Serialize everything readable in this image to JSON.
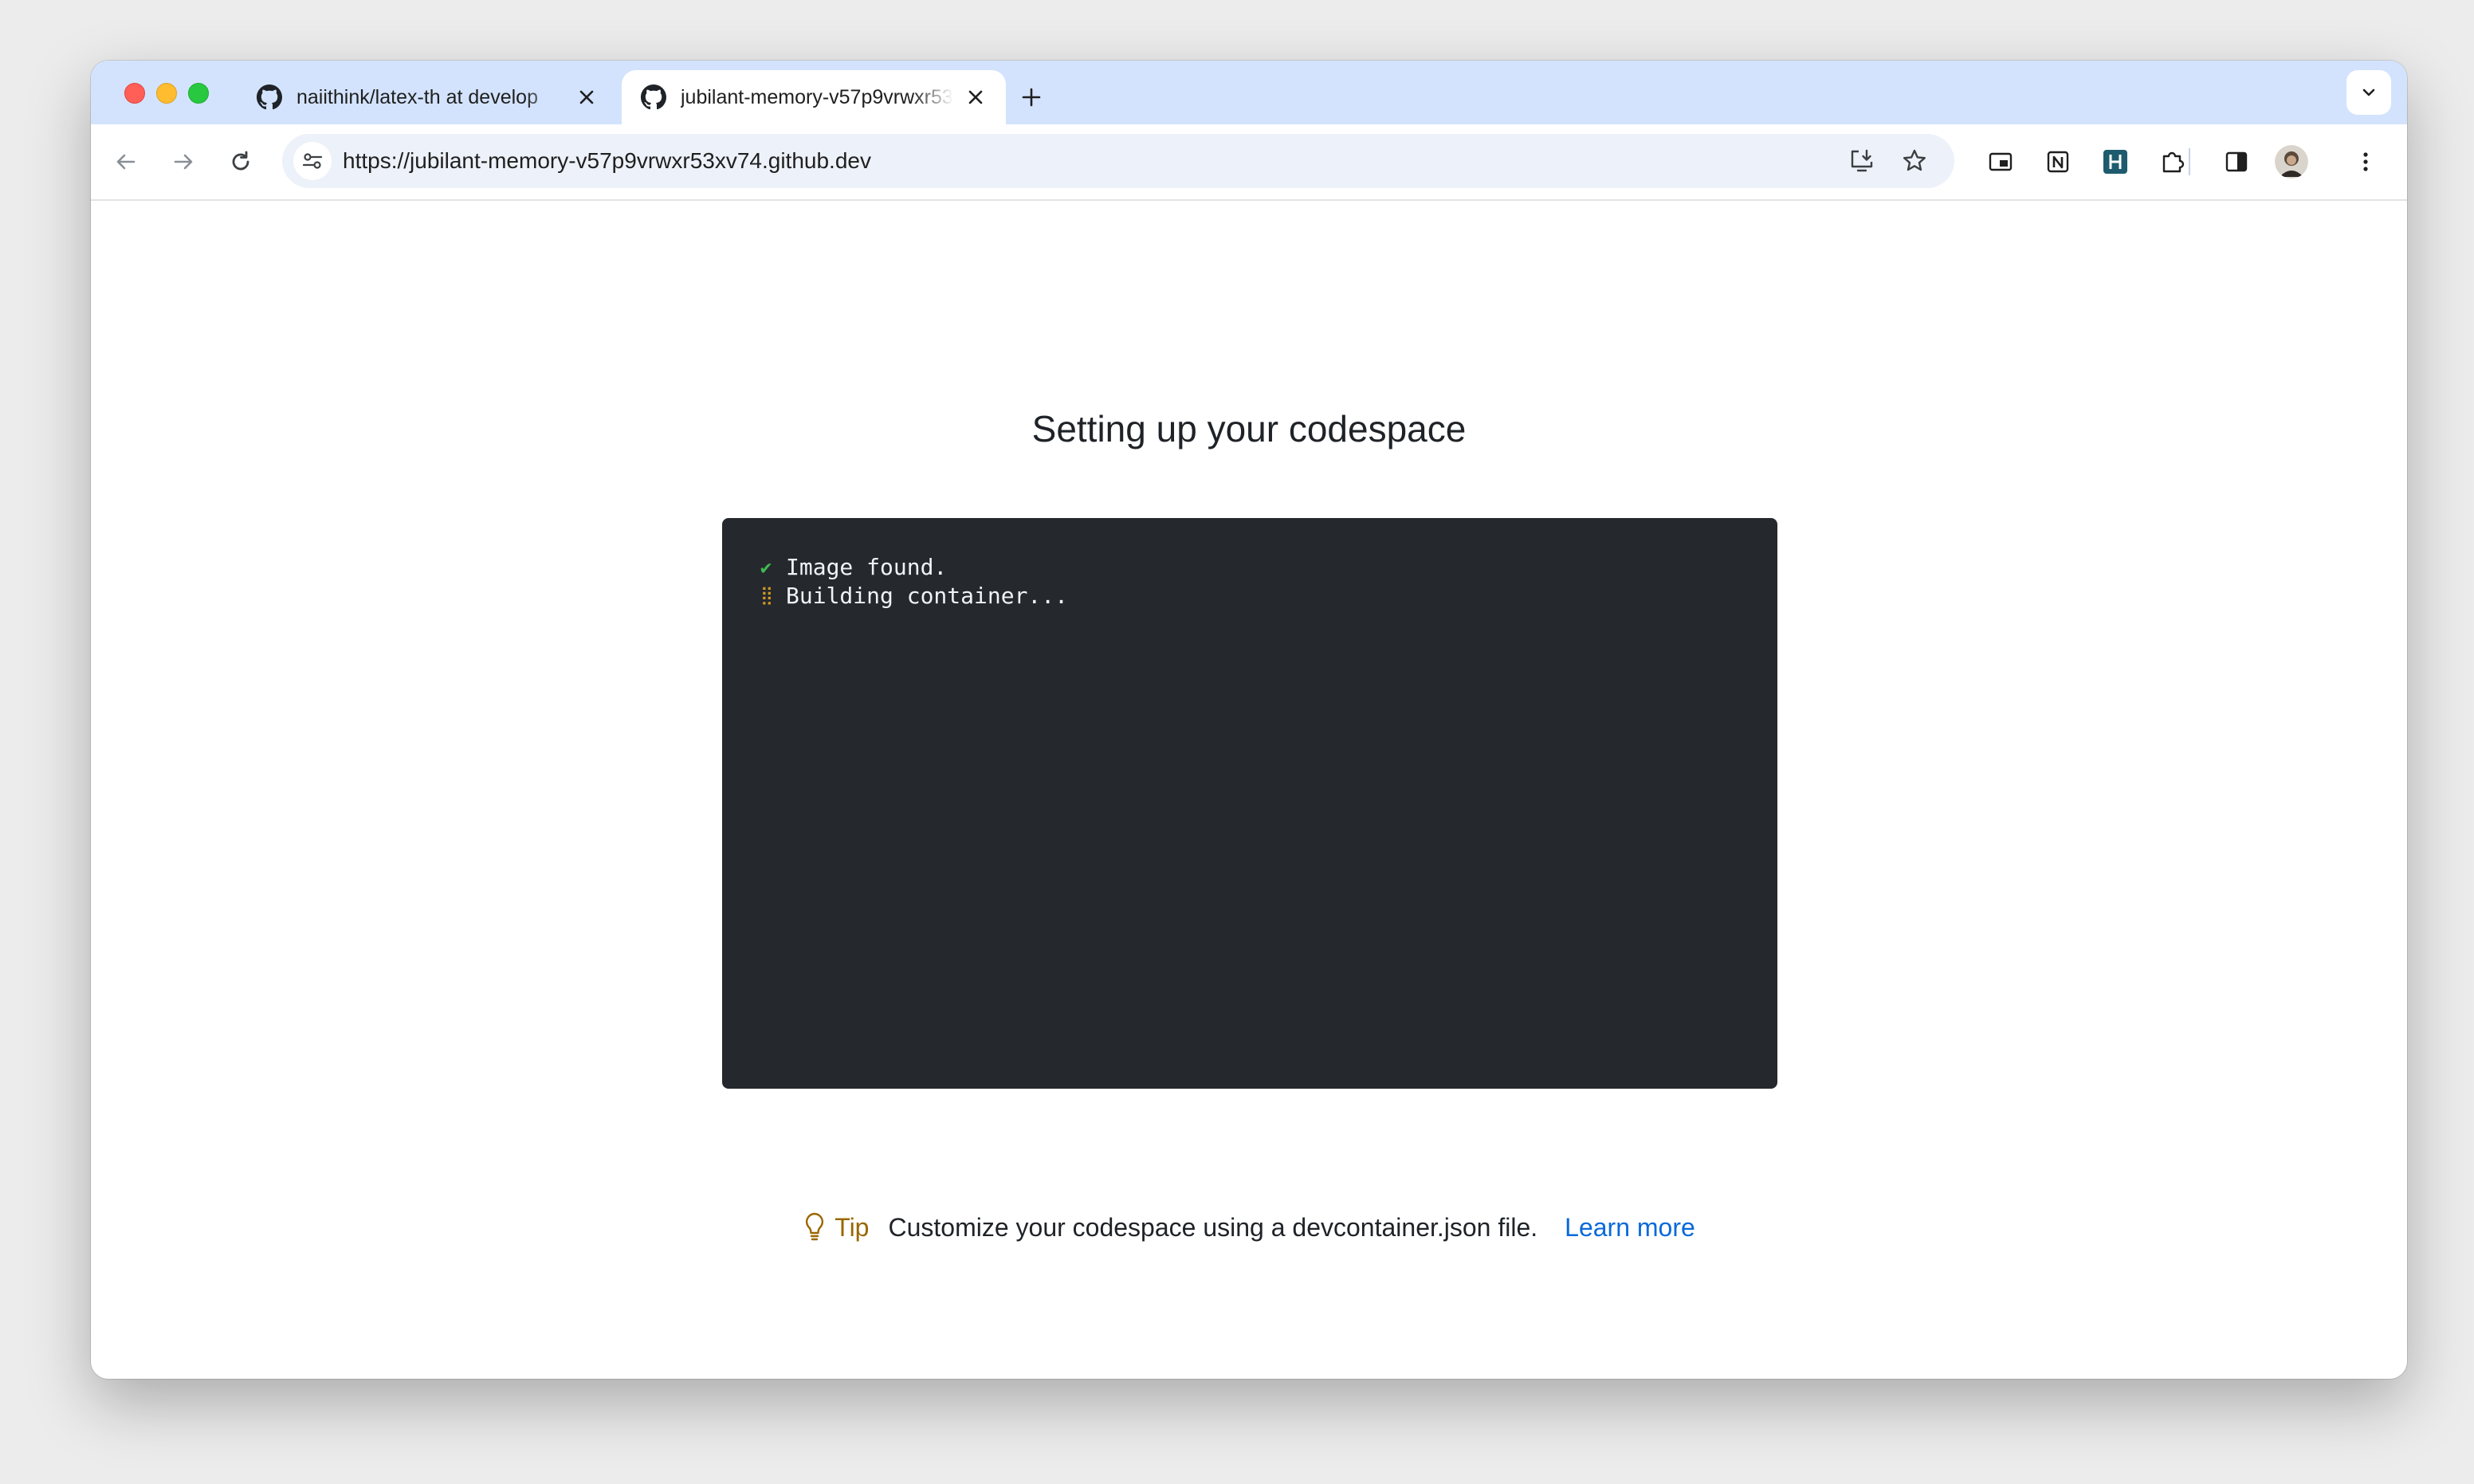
{
  "browser": {
    "tabs": [
      {
        "title": "naiithink/latex-th at develop",
        "icon": "github-icon",
        "active": false
      },
      {
        "title": "jubilant-memory-v57p9vrwxr53xv74",
        "icon": "github-icon",
        "active": true
      }
    ],
    "address_bar": {
      "url": "https://jubilant-memory-v57p9vrwxr53xv74.github.dev"
    },
    "extensions": [
      "picture-in-picture-icon",
      "notion-icon",
      "hashnode-icon",
      "puzzle-icon"
    ]
  },
  "page": {
    "title": "Setting up your codespace",
    "log": [
      {
        "status": "done",
        "mark": "✔",
        "text": "Image found."
      },
      {
        "status": "in-progress",
        "mark": "⣿",
        "text": "Building container..."
      }
    ],
    "tip": {
      "label": "Tip",
      "text": "Customize your codespace using a devcontainer.json file.",
      "link_label": "Learn more"
    }
  },
  "colors": {
    "tabstrip": "#d3e3fd",
    "terminal_bg": "#25282d",
    "check": "#3fb950",
    "spinner": "#d29922",
    "tip": "#9a6700",
    "link": "#0969da"
  }
}
